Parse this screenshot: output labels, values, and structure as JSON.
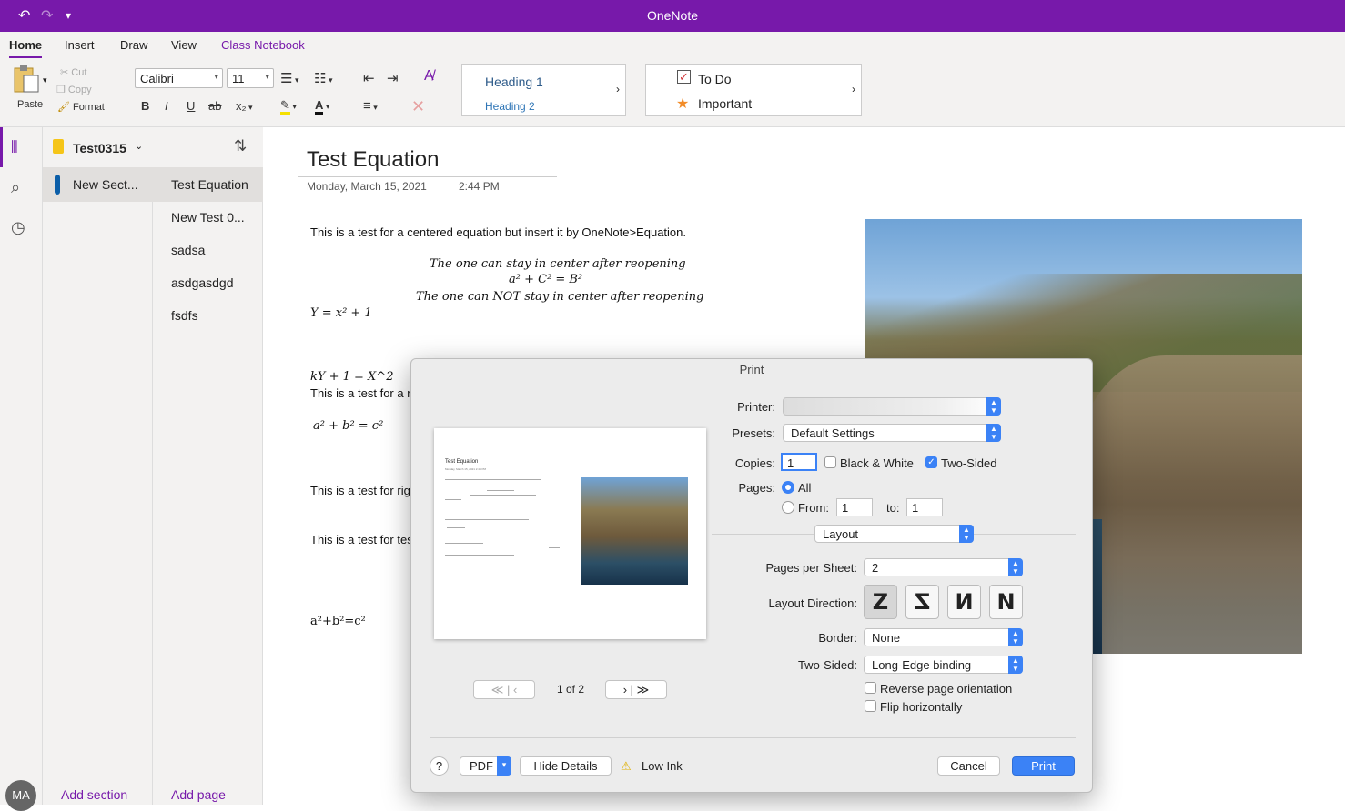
{
  "app": {
    "title": "OneNote"
  },
  "quick_access": {
    "undo": "↶",
    "redo": "↷",
    "customize": "▾"
  },
  "tabs": [
    {
      "label": "Home"
    },
    {
      "label": "Insert"
    },
    {
      "label": "Draw"
    },
    {
      "label": "View"
    },
    {
      "label": "Class Notebook"
    }
  ],
  "ribbon": {
    "paste": "Paste",
    "cut": "Cut",
    "copy": "Copy",
    "format": "Format",
    "font": "Calibri",
    "size": "11",
    "bold": "B",
    "italic": "I",
    "underline": "U",
    "strike": "ab",
    "subscript": "x₂",
    "styles": {
      "h1": "Heading 1",
      "h2": "Heading 2"
    },
    "tags": {
      "todo": "To Do",
      "important": "Important"
    }
  },
  "notebook": {
    "name": "Test0315"
  },
  "sections": [
    {
      "label": "New Sect..."
    }
  ],
  "pages": [
    {
      "label": "Test Equation"
    },
    {
      "label": "New Test 0..."
    },
    {
      "label": "sadsa"
    },
    {
      "label": "asdgasdgd"
    },
    {
      "label": "fsdfs"
    }
  ],
  "footer": {
    "add_section": "Add section",
    "add_page": "Add page",
    "avatar": "MA"
  },
  "page": {
    "title": "Test Equation",
    "date": "Monday, March 15, 2021",
    "time": "2:44 PM",
    "lines": {
      "l1": "This is a test for a centered equation but insert it by OneNote>Equation.",
      "c1": "The one can stay in center after reopening",
      "c2": "a² + C² = B²",
      "c3": "The one can NOT stay in center after reopening",
      "eq1": "Y = x² + 1",
      "eq2": "kY + 1 = X^2",
      "l2": "This is a test for a n",
      "eq3": "a² + b² = c²",
      "l3": "This is a test for rig",
      "l4": "This is a test for tes",
      "eq4": "a²+b²=c²"
    }
  },
  "print_dialog": {
    "title": "Print",
    "printer_label": "Printer:",
    "presets_label": "Presets:",
    "presets_value": "Default Settings",
    "copies_label": "Copies:",
    "copies_value": "1",
    "bw_label": "Black & White",
    "two_sided_label": "Two-Sided",
    "pages_label": "Pages:",
    "all_label": "All",
    "from_label": "From:",
    "from_value": "1",
    "to_label": "to:",
    "to_value": "1",
    "section_value": "Layout",
    "pps_label": "Pages per Sheet:",
    "pps_value": "2",
    "layout_dir_label": "Layout Direction:",
    "layout_dir_icons": [
      "Z",
      "Z",
      "И",
      "N"
    ],
    "border_label": "Border:",
    "border_value": "None",
    "twosided_label": "Two-Sided:",
    "twosided_value": "Long-Edge binding",
    "reverse_label": "Reverse page orientation",
    "flip_label": "Flip horizontally",
    "page_indicator": "1 of 2",
    "nav_first": "≪",
    "nav_prev": "‹",
    "nav_next": "›",
    "nav_last": "≫",
    "help": "?",
    "pdf": "PDF",
    "hide_details": "Hide Details",
    "low_ink": "Low Ink",
    "cancel": "Cancel",
    "print": "Print"
  },
  "preview": {
    "title": "Test Equation",
    "date": "Monday, March 15, 2021       2:44 PM"
  },
  "colors": {
    "accent": "#7719aa",
    "mac_blue": "#3b82f6"
  }
}
